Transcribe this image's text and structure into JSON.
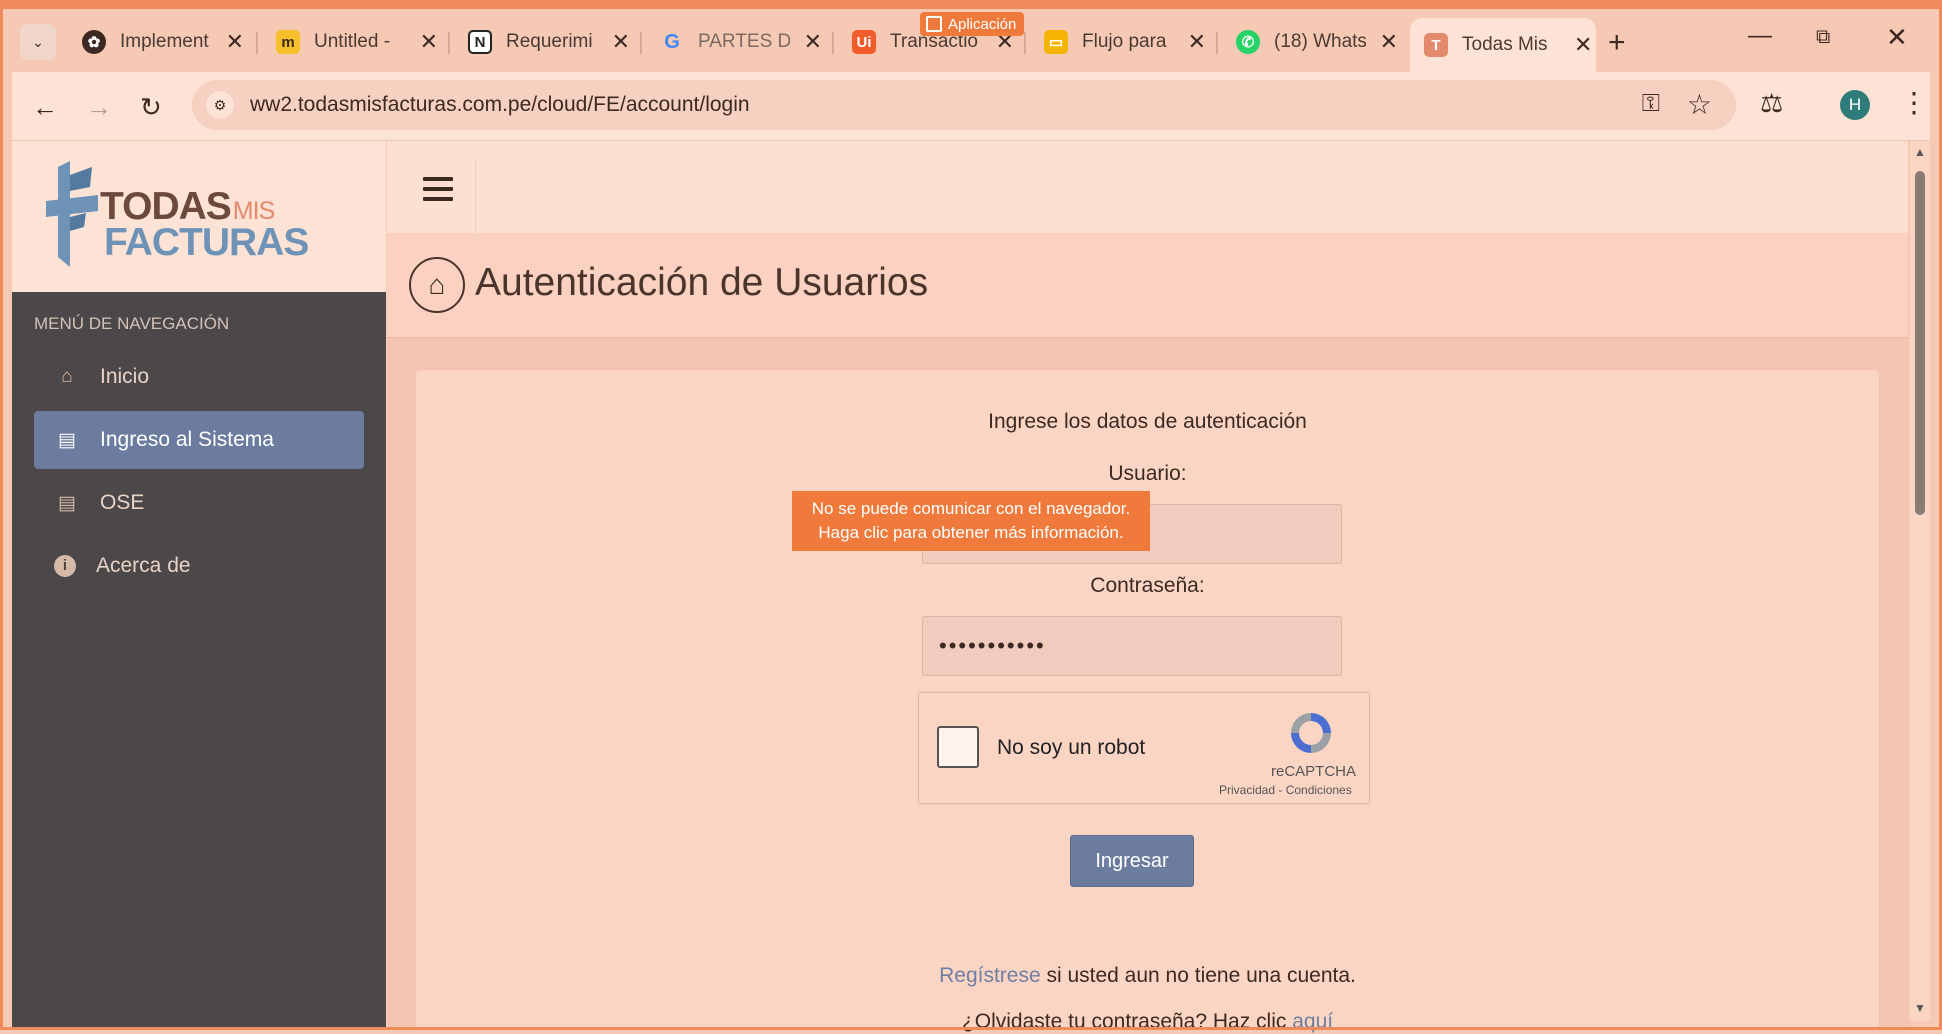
{
  "browser": {
    "tabs": [
      {
        "title": "Implement",
        "icon": "openai-icon",
        "color": "#3c2a22"
      },
      {
        "title": "Untitled - ",
        "icon": "miro-icon",
        "color": "#f6c02b"
      },
      {
        "title": "Requerimi",
        "icon": "notion-icon",
        "color": "#3c2a22"
      },
      {
        "title": "PARTES DE",
        "icon": "google-icon",
        "color": "#4285f4"
      },
      {
        "title": "Transactio",
        "icon": "uipath-icon",
        "color": "#f25c2a"
      },
      {
        "title": "Flujo para",
        "icon": "slides-icon",
        "color": "#f4b400"
      },
      {
        "title": "(18) Whats",
        "icon": "whatsapp-icon",
        "color": "#25d366"
      },
      {
        "title": "Todas Mis",
        "icon": "todasmisfacturas-icon",
        "color": "#e38a6c",
        "active": true
      }
    ],
    "app_badge": "Aplicación",
    "url": "ww2.todasmisfacturas.com.pe/cloud/FE/account/login",
    "profile_initial": "H"
  },
  "logo": {
    "line1": "TODAS",
    "mis": "MIS",
    "line2": "FACTURAS"
  },
  "sidebar": {
    "header": "MENÚ DE NAVEGACIÓN",
    "items": [
      {
        "label": "Inicio",
        "icon": "home-icon"
      },
      {
        "label": "Ingreso al Sistema",
        "icon": "list-icon",
        "active": true
      },
      {
        "label": "OSE",
        "icon": "list-icon"
      },
      {
        "label": "Acerca de",
        "icon": "info-icon"
      }
    ]
  },
  "page": {
    "title": "Autenticación de Usuarios",
    "instructions": "Ingrese los datos de autenticación",
    "username_label": "Usuario:",
    "username_value": "",
    "password_label": "Contraseña:",
    "password_value": "•••••••••••",
    "captcha_label": "No soy un robot",
    "captcha_brand": "reCAPTCHA",
    "captcha_links": "Privacidad - Condiciones",
    "submit_label": "Ingresar",
    "register_link": "Regístrese",
    "register_text": " si usted aun no tiene una cuenta.",
    "forgot_text": "¿Olvidaste tu contraseña? Haz clic ",
    "forgot_link": "aquí"
  },
  "tooltip": {
    "line1": "No se puede comunicar con el navegador.",
    "line2": "Haga clic para obtener más información."
  },
  "colors": {
    "accent": "#6b7c9f",
    "sidebar": "#4c4849",
    "tooltip": "#f07a3c"
  }
}
